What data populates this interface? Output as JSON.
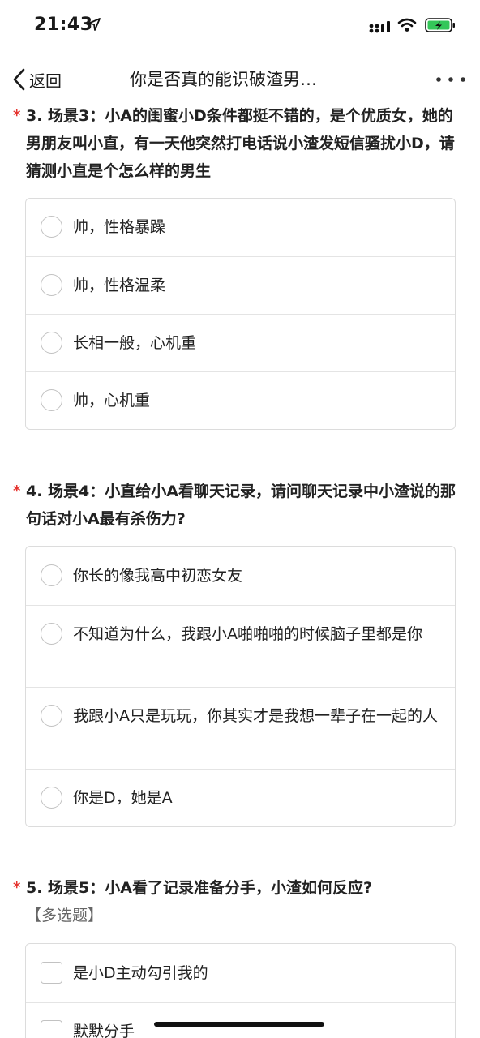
{
  "status_bar": {
    "time": "21:43"
  },
  "nav": {
    "back_label": "返回",
    "title": "你是否真的能识破渣男…"
  },
  "questions": [
    {
      "star": "*",
      "title": "3. 场景3：小A的闺蜜小D条件都挺不错的，是个优质女，她的男朋友叫小直，有一天他突然打电话说小渣发短信骚扰小D，请猜测小直是个怎么样的男生",
      "options": [
        "帅，性格暴躁",
        "帅，性格温柔",
        "长相一般，心机重",
        "帅，心机重"
      ]
    },
    {
      "star": "*",
      "title": "4. 场景4：小直给小A看聊天记录，请问聊天记录中小渣说的那句话对小A最有杀伤力?",
      "options": [
        "你长的像我高中初恋女友",
        "不知道为什么，我跟小A啪啪啪的时候脑子里都是你",
        "我跟小A只是玩玩，你其实才是我想一辈子在一起的人",
        "你是D，她是A"
      ]
    },
    {
      "star": "*",
      "title": "5. 场景5：小A看了记录准备分手，小渣如何反应?",
      "subtitle": "【多选题】",
      "options": [
        "是小D主动勾引我的",
        "默默分手"
      ]
    }
  ]
}
